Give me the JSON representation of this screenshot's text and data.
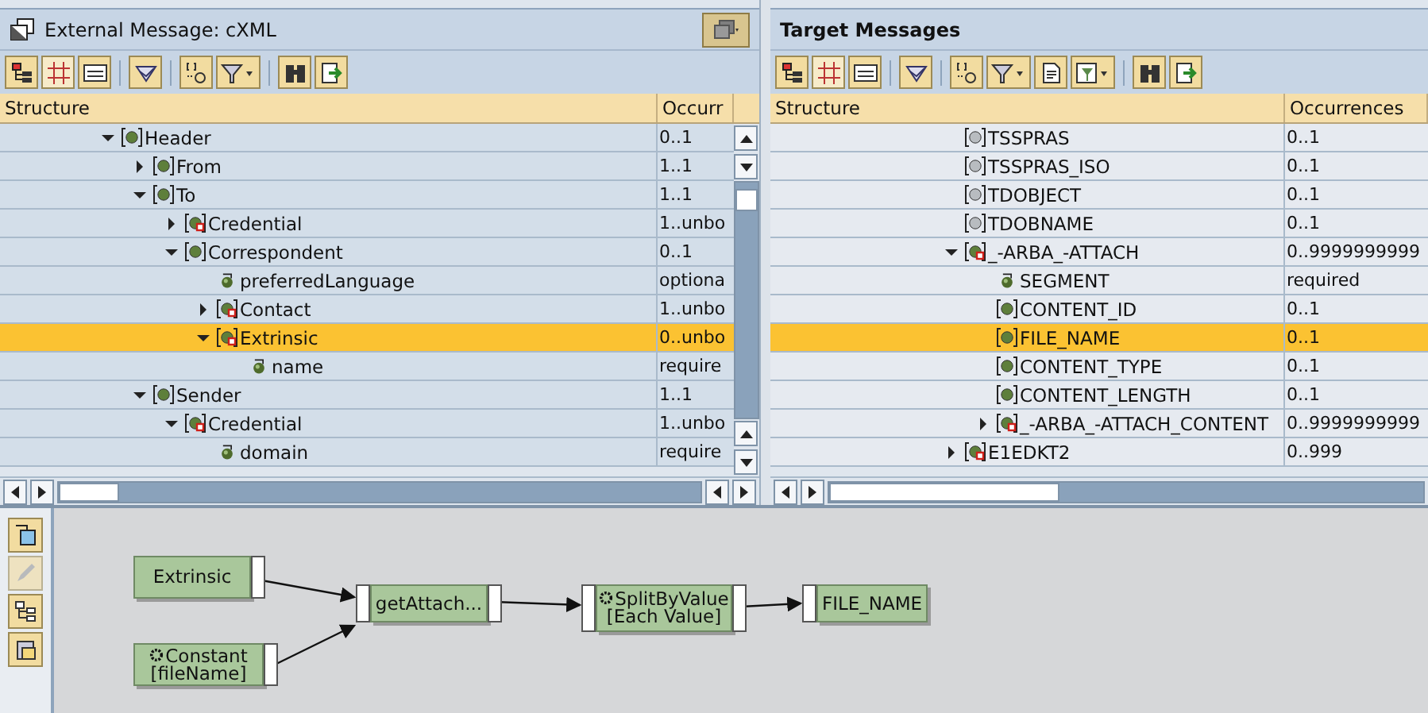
{
  "source": {
    "title": "External Message: cXML",
    "columns": [
      "Structure",
      "Occurr"
    ],
    "tree": [
      {
        "label": "Header",
        "kind": "element",
        "occurrence": "0..1",
        "expanded": true,
        "selected": false,
        "children": [
          {
            "label": "From",
            "kind": "element",
            "occurrence": "1..1",
            "expanded": false,
            "selected": false
          },
          {
            "label": "To",
            "kind": "element",
            "occurrence": "1..1",
            "expanded": true,
            "selected": false,
            "children": [
              {
                "label": "Credential",
                "kind": "element-list",
                "occurrence": "1..unbo",
                "expanded": false,
                "selected": false
              },
              {
                "label": "Correspondent",
                "kind": "element",
                "occurrence": "0..1",
                "expanded": true,
                "selected": false,
                "children": [
                  {
                    "label": "preferredLanguage",
                    "kind": "attribute",
                    "occurrence": "optiona",
                    "selected": false
                  },
                  {
                    "label": "Contact",
                    "kind": "element-list",
                    "occurrence": "1..unbo",
                    "expanded": false,
                    "selected": false
                  },
                  {
                    "label": "Extrinsic",
                    "kind": "element-list",
                    "occurrence": "0..unbo",
                    "expanded": true,
                    "selected": true,
                    "children": [
                      {
                        "label": "name",
                        "kind": "attribute",
                        "occurrence": "require",
                        "selected": false
                      }
                    ]
                  }
                ]
              }
            ]
          },
          {
            "label": "Sender",
            "kind": "element",
            "occurrence": "1..1",
            "expanded": true,
            "selected": false,
            "children": [
              {
                "label": "Credential",
                "kind": "element-list",
                "occurrence": "1..unbo",
                "expanded": true,
                "selected": false,
                "children": [
                  {
                    "label": "domain",
                    "kind": "attribute",
                    "occurrence": "require",
                    "selected": false
                  }
                ]
              }
            ]
          }
        ]
      }
    ]
  },
  "target": {
    "title": "Target Messages",
    "columns": [
      "Structure",
      "Occurrences"
    ],
    "tree": [
      {
        "label": "TSSPRAS",
        "kind": "field",
        "occurrence": "0..1",
        "selected": false
      },
      {
        "label": "TSSPRAS_ISO",
        "kind": "field",
        "occurrence": "0..1",
        "selected": false
      },
      {
        "label": "TDOBJECT",
        "kind": "field",
        "occurrence": "0..1",
        "selected": false
      },
      {
        "label": "TDOBNAME",
        "kind": "field",
        "occurrence": "0..1",
        "selected": false
      },
      {
        "label": "_-ARBA_-ATTACH",
        "kind": "element-list",
        "occurrence": "0..9999999999",
        "expanded": true,
        "selected": false,
        "children": [
          {
            "label": "SEGMENT",
            "kind": "attribute",
            "occurrence": "required",
            "selected": false
          },
          {
            "label": "CONTENT_ID",
            "kind": "element",
            "occurrence": "0..1",
            "selected": false
          },
          {
            "label": "FILE_NAME",
            "kind": "element",
            "occurrence": "0..1",
            "selected": true
          },
          {
            "label": "CONTENT_TYPE",
            "kind": "element",
            "occurrence": "0..1",
            "selected": false
          },
          {
            "label": "CONTENT_LENGTH",
            "kind": "element",
            "occurrence": "0..1",
            "selected": false
          },
          {
            "label": "_-ARBA_-ATTACH_CONTENT",
            "kind": "element-list",
            "occurrence": "0..9999999999",
            "expanded": false,
            "selected": false
          }
        ]
      },
      {
        "label": "E1EDKT2",
        "kind": "element-list",
        "occurrence": "0..999",
        "expanded": false,
        "selected": false
      }
    ]
  },
  "mapping": {
    "nodes": [
      {
        "kind": "source",
        "lines": [
          "Extrinsic"
        ]
      },
      {
        "kind": "constant",
        "lines": [
          "Constant",
          "[fileName]"
        ]
      },
      {
        "kind": "function",
        "lines": [
          "getAttach..."
        ]
      },
      {
        "kind": "standard-function",
        "lines": [
          "SplitByValue",
          "[Each Value]"
        ]
      },
      {
        "kind": "target",
        "lines": [
          "FILE_NAME"
        ]
      }
    ]
  }
}
